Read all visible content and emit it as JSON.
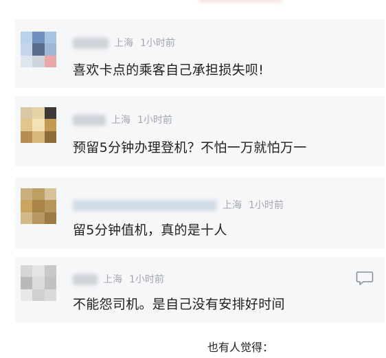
{
  "comments": [
    {
      "location": "上海",
      "time": "1小时前",
      "text": "喜欢卡点的乘客自己承担损失呗!"
    },
    {
      "location": "上海",
      "time": "1小时前",
      "text": "预留5分钟办理登机？不怕一万就怕万一"
    },
    {
      "location": "上海",
      "time": "1小时前",
      "text": "留5分钟值机，真的是十人"
    },
    {
      "location": "上海",
      "time": "1小时前",
      "text": "不能怨司机。是自己没有安排好时间"
    }
  ],
  "footer": {
    "text": "也有人觉得："
  },
  "icons": {
    "reply": "comment-bubble-icon"
  }
}
